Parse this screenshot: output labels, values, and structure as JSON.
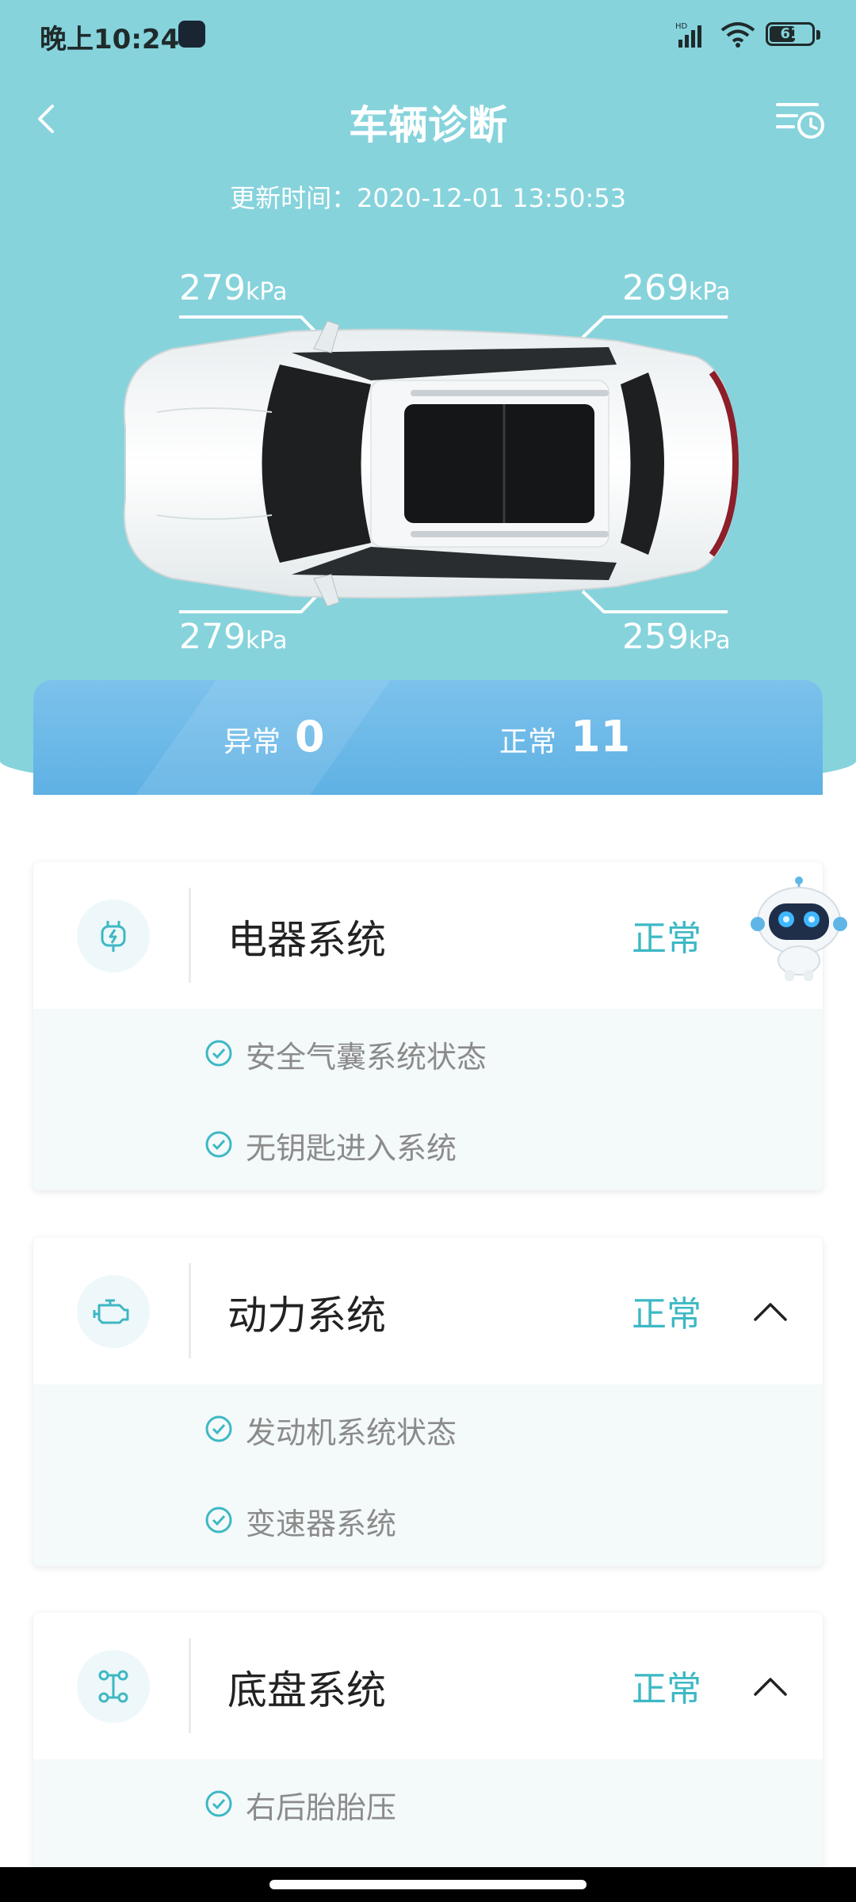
{
  "status_bar": {
    "time": "晚上10:24",
    "battery": "61",
    "battery_fraction": 0.61,
    "signal_label": "HD"
  },
  "header": {
    "title": "车辆诊断",
    "update_time": "更新时间：2020-12-01 13:50:53"
  },
  "tires": {
    "front_left": {
      "value": "279",
      "unit": "kPa"
    },
    "front_right": {
      "value": "269",
      "unit": "kPa"
    },
    "rear_left": {
      "value": "279",
      "unit": "kPa"
    },
    "rear_right": {
      "value": "259",
      "unit": "kPa"
    }
  },
  "summary": {
    "abnormal_label": "异常",
    "abnormal_count": "0",
    "normal_label": "正常",
    "normal_count": "11"
  },
  "cards": [
    {
      "title": "电器系统",
      "status": "正常",
      "items": [
        "安全气囊系统状态",
        "无钥匙进入系统"
      ]
    },
    {
      "title": "动力系统",
      "status": "正常",
      "items": [
        "发动机系统状态",
        "变速器系统"
      ]
    },
    {
      "title": "底盘系统",
      "status": "正常",
      "items": [
        "右后胎胎压"
      ]
    }
  ],
  "colors": {
    "hero": "#86d3dc",
    "accent": "#3db8c4",
    "summary": "#6ab7e8"
  },
  "icons": {
    "back": "chevron-left-icon",
    "history": "history-list-icon",
    "electrical": "plug-icon",
    "engine": "engine-icon",
    "chassis": "chassis-icon",
    "check": "check-circle-icon",
    "expand": "chevron-up-icon"
  }
}
